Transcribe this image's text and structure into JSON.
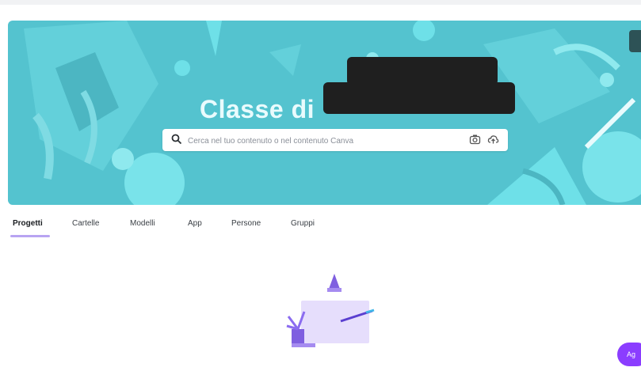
{
  "banner": {
    "title": "Classe di",
    "title_redacted": true,
    "background_color": "#54c3cf"
  },
  "search": {
    "placeholder": "Cerca nel tuo contenuto o nel contenuto Canva",
    "value": "",
    "icons": [
      "search-icon",
      "camera-icon",
      "upload-icon"
    ]
  },
  "tabs": [
    {
      "label": "Progetti",
      "active": true
    },
    {
      "label": "Cartelle",
      "active": false
    },
    {
      "label": "Modelli",
      "active": false
    },
    {
      "label": "App",
      "active": false
    },
    {
      "label": "Persone",
      "active": false
    },
    {
      "label": "Gruppi",
      "active": false
    }
  ],
  "fab": {
    "label": "Ag"
  },
  "colors": {
    "accent": "#8b3dff",
    "tab_underline": "#b8a4f2"
  }
}
